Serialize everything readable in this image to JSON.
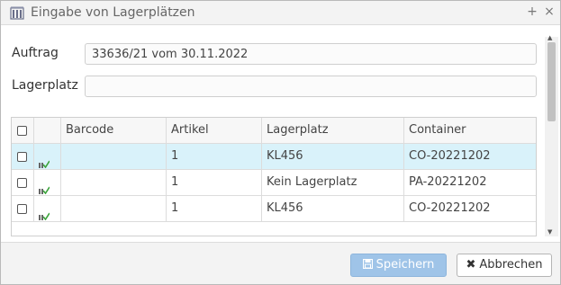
{
  "window": {
    "title": "Eingabe von Lagerplätzen",
    "icon": "warehouse-icon",
    "pin_glyph": "+",
    "close_glyph": "×"
  },
  "form": {
    "auftrag": {
      "label": "Auftrag",
      "value": "33636/21 vom 30.11.2022"
    },
    "lagerplatz": {
      "label": "Lagerplatz",
      "value": ""
    }
  },
  "grid": {
    "columns": [
      "",
      "",
      "Barcode",
      "Artikel",
      "Lagerplatz",
      "Container"
    ],
    "rows": [
      {
        "barcode": "",
        "artikel": "1",
        "lagerplatz": "KL456",
        "container": "CO-20221202",
        "selected": true
      },
      {
        "barcode": "",
        "artikel": "1",
        "lagerplatz": "Kein Lagerplatz",
        "container": "PA-20221202",
        "selected": false
      },
      {
        "barcode": "",
        "artikel": "1",
        "lagerplatz": "KL456",
        "container": "CO-20221202",
        "selected": false
      }
    ]
  },
  "footer": {
    "save_label": "Speichern",
    "cancel_label": "Abbrechen"
  },
  "colors": {
    "selected_row": "#d9f2fa",
    "save_button": "#9fc4e8",
    "status_icon_green": "#3aa33a"
  }
}
